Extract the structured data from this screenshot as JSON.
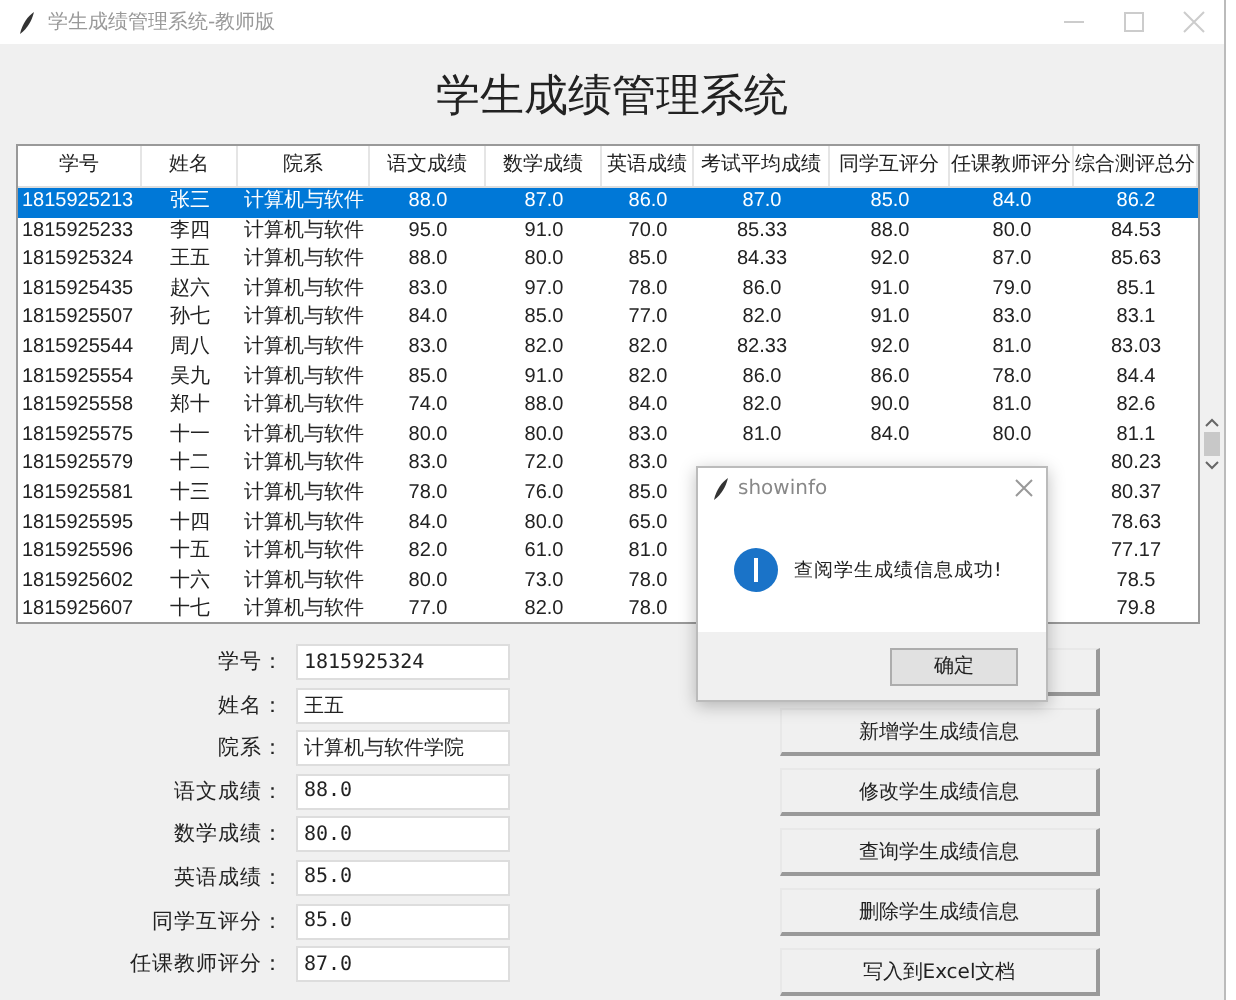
{
  "window": {
    "title": "学生成绩管理系统-教师版"
  },
  "heading": "学生成绩管理系统",
  "table": {
    "columns": [
      "学号",
      "姓名",
      "院系",
      "语文成绩",
      "数学成绩",
      "英语成绩",
      "考试平均成绩",
      "同学互评分",
      "任课教师评分",
      "综合测评总分"
    ],
    "rows": [
      {
        "selected": true,
        "cells": [
          "1815925213",
          "张三",
          "计算机与软件",
          "88.0",
          "87.0",
          "86.0",
          "87.0",
          "85.0",
          "84.0",
          "86.2"
        ]
      },
      {
        "selected": false,
        "cells": [
          "1815925233",
          "李四",
          "计算机与软件",
          "95.0",
          "91.0",
          "70.0",
          "85.33",
          "88.0",
          "80.0",
          "84.53"
        ]
      },
      {
        "selected": false,
        "cells": [
          "1815925324",
          "王五",
          "计算机与软件",
          "88.0",
          "80.0",
          "85.0",
          "84.33",
          "92.0",
          "87.0",
          "85.63"
        ]
      },
      {
        "selected": false,
        "cells": [
          "1815925435",
          "赵六",
          "计算机与软件",
          "83.0",
          "97.0",
          "78.0",
          "86.0",
          "91.0",
          "79.0",
          "85.1"
        ]
      },
      {
        "selected": false,
        "cells": [
          "1815925507",
          "孙七",
          "计算机与软件",
          "84.0",
          "85.0",
          "77.0",
          "82.0",
          "91.0",
          "83.0",
          "83.1"
        ]
      },
      {
        "selected": false,
        "cells": [
          "1815925544",
          "周八",
          "计算机与软件",
          "83.0",
          "82.0",
          "82.0",
          "82.33",
          "92.0",
          "81.0",
          "83.03"
        ]
      },
      {
        "selected": false,
        "cells": [
          "1815925554",
          "吴九",
          "计算机与软件",
          "85.0",
          "91.0",
          "82.0",
          "86.0",
          "86.0",
          "78.0",
          "84.4"
        ]
      },
      {
        "selected": false,
        "cells": [
          "1815925558",
          "郑十",
          "计算机与软件",
          "74.0",
          "88.0",
          "84.0",
          "82.0",
          "90.0",
          "81.0",
          "82.6"
        ]
      },
      {
        "selected": false,
        "cells": [
          "1815925575",
          "十一",
          "计算机与软件",
          "80.0",
          "80.0",
          "83.0",
          "81.0",
          "84.0",
          "80.0",
          "81.1"
        ]
      },
      {
        "selected": false,
        "cells": [
          "1815925579",
          "十二",
          "计算机与软件",
          "83.0",
          "72.0",
          "83.0",
          null,
          null,
          null,
          "80.23"
        ]
      },
      {
        "selected": false,
        "cells": [
          "1815925581",
          "十三",
          "计算机与软件",
          "78.0",
          "76.0",
          "85.0",
          null,
          null,
          null,
          "80.37"
        ]
      },
      {
        "selected": false,
        "cells": [
          "1815925595",
          "十四",
          "计算机与软件",
          "84.0",
          "80.0",
          "65.0",
          null,
          null,
          null,
          "78.63"
        ]
      },
      {
        "selected": false,
        "cells": [
          "1815925596",
          "十五",
          "计算机与软件",
          "82.0",
          "61.0",
          "81.0",
          null,
          null,
          null,
          "77.17"
        ]
      },
      {
        "selected": false,
        "cells": [
          "1815925602",
          "十六",
          "计算机与软件",
          "80.0",
          "73.0",
          "78.0",
          null,
          null,
          null,
          "78.5"
        ]
      },
      {
        "selected": false,
        "cells": [
          "1815925607",
          "十七",
          "计算机与软件",
          "77.0",
          "82.0",
          "78.0",
          null,
          null,
          null,
          "79.8"
        ]
      }
    ]
  },
  "form": {
    "fields": [
      {
        "label": "学号：",
        "value": "1815925324"
      },
      {
        "label": "姓名：",
        "value": "王五"
      },
      {
        "label": "院系：",
        "value": "计算机与软件学院"
      },
      {
        "label": "语文成绩：",
        "value": "88.0"
      },
      {
        "label": "数学成绩：",
        "value": "80.0"
      },
      {
        "label": "英语成绩：",
        "value": "85.0"
      },
      {
        "label": "同学互评分：",
        "value": "85.0"
      },
      {
        "label": "任课教师评分：",
        "value": "87.0"
      }
    ]
  },
  "buttons": [
    {
      "kind": "covered"
    },
    {
      "kind": "text",
      "label": "新增学生成绩信息"
    },
    {
      "kind": "text",
      "label": "修改学生成绩信息"
    },
    {
      "kind": "text",
      "label": "查询学生成绩信息"
    },
    {
      "kind": "text",
      "label": "删除学生成绩信息"
    },
    {
      "kind": "text",
      "label": "写入到Excel文档"
    }
  ],
  "dialog": {
    "title": "showinfo",
    "message": "查阅学生成绩信息成功!",
    "buttons": [
      "确定"
    ]
  }
}
